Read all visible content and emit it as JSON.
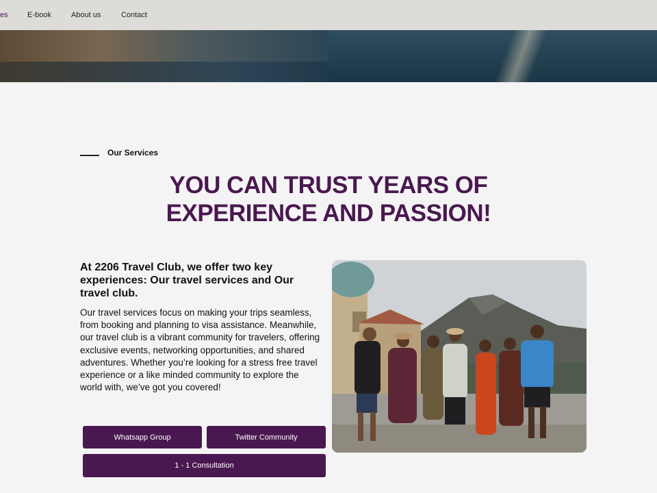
{
  "nav": {
    "items": [
      {
        "label": "es",
        "active": true
      },
      {
        "label": "E-book"
      },
      {
        "label": "About us"
      },
      {
        "label": "Contact"
      }
    ]
  },
  "services": {
    "eyebrow": "Our Services",
    "headline_line1": "YOU CAN TRUST YEARS OF",
    "headline_line2": "EXPERIENCE AND PASSION!",
    "subhead": "At 2206 Travel Club, we offer two key experiences: Our travel services and Our travel club.",
    "body": "Our travel services focus on making your trips seamless, from booking and planning to visa assistance. Meanwhile, our travel club is a vibrant community for travelers, offering exclusive events, networking opportunities, and shared adventures. Whether you’re looking for a stress free travel experience or a like minded community to explore the world with, we’ve got you covered!",
    "buttons": {
      "whatsapp": "Whatsapp Group",
      "twitter": "Twitter Community",
      "consultation": "1 - 1 Consultation"
    }
  },
  "colors": {
    "brand_purple": "#4a1850",
    "background": "#f4f4f4",
    "navbar": "#dddcd9"
  }
}
